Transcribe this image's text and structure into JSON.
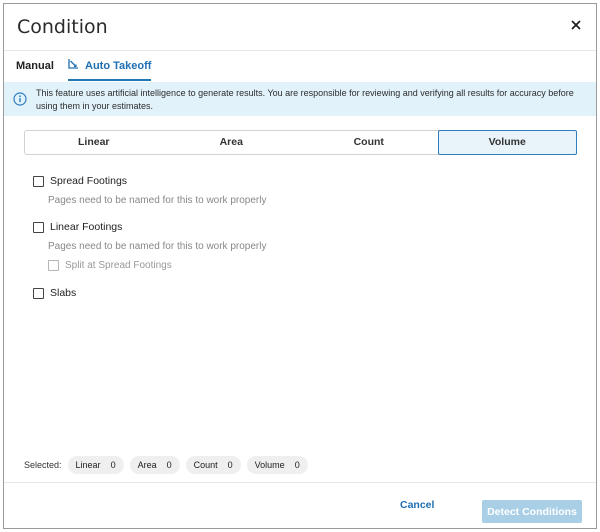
{
  "dialog": {
    "title": "Condition",
    "close_icon": "close-icon"
  },
  "tabs": {
    "manual": "Manual",
    "auto": "Auto Takeoff",
    "auto_icon": "takeoff-icon",
    "active": "Auto Takeoff"
  },
  "notice": {
    "icon": "info-icon",
    "text": "This feature uses artificial intelligence to generate results. You are responsible for reviewing and verifying all results for accuracy before using them in your estimates."
  },
  "segments": {
    "items": [
      "Linear",
      "Area",
      "Count",
      "Volume"
    ],
    "active": "Volume"
  },
  "options": {
    "spread_footings": {
      "label": "Spread Footings",
      "hint": "Pages need to be named for this to work properly"
    },
    "linear_footings": {
      "label": "Linear Footings",
      "hint": "Pages need to be named for this to work properly",
      "sub_label": "Split at Spread Footings"
    },
    "slabs": {
      "label": "Slabs"
    }
  },
  "selected": {
    "label": "Selected:",
    "chips": [
      {
        "label": "Linear",
        "count": "0"
      },
      {
        "label": "Area",
        "count": "0"
      },
      {
        "label": "Count",
        "count": "0"
      },
      {
        "label": "Volume",
        "count": "0"
      }
    ]
  },
  "footer": {
    "cancel": "Cancel",
    "detect": "Detect Conditions"
  },
  "colors": {
    "accent": "#1f78b4",
    "notice_bg": "#e2f2fb",
    "detect_disabled": "#a9cfe7"
  }
}
